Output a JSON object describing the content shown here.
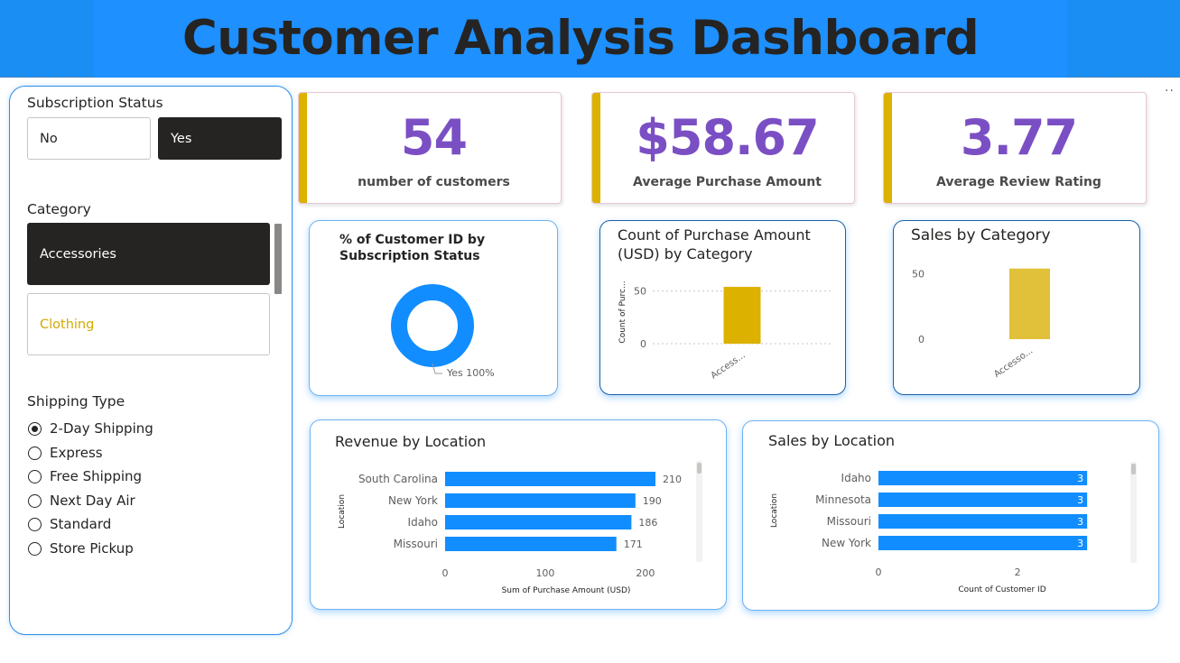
{
  "header": {
    "title": "Customer Analysis Dashboard",
    "more_options": "··"
  },
  "colors": {
    "header_blue": "#1e90ff",
    "kpi_value_purple": "#7b4fc4",
    "kpi_accent_gold": "#dcb100",
    "bar_blue": "#118dff",
    "bar_gold": "#dcb100",
    "selected_tile": "#252423"
  },
  "filters": {
    "subscription": {
      "title": "Subscription Status",
      "options": [
        {
          "label": "No",
          "selected": false
        },
        {
          "label": "Yes",
          "selected": true
        }
      ]
    },
    "category": {
      "title": "Category",
      "options": [
        {
          "label": "Accessories",
          "selected": true
        },
        {
          "label": "Clothing",
          "selected": false
        }
      ]
    },
    "shipping": {
      "title": "Shipping Type",
      "options": [
        {
          "label": "2-Day Shipping",
          "selected": true
        },
        {
          "label": "Express",
          "selected": false
        },
        {
          "label": "Free Shipping",
          "selected": false
        },
        {
          "label": "Next Day Air",
          "selected": false
        },
        {
          "label": "Standard",
          "selected": false
        },
        {
          "label": "Store Pickup",
          "selected": false
        }
      ]
    }
  },
  "kpis": [
    {
      "value": "54",
      "label": "number of customers"
    },
    {
      "value": "$58.67",
      "label": "Average Purchase Amount"
    },
    {
      "value": "3.77",
      "label": "Average Review Rating"
    }
  ],
  "chart_data": [
    {
      "type": "pie",
      "title": "% of Customer ID by Subscription Status",
      "slices": [
        {
          "label": "Yes",
          "value": 100,
          "data_label": "Yes 100%"
        }
      ],
      "donut": true
    },
    {
      "type": "bar",
      "title": "Count of Purchase Amount (USD) by Category",
      "categories": [
        "Access..."
      ],
      "values": [
        54
      ],
      "ylabel": "Count of Purc...",
      "ticks": [
        "0",
        "50"
      ],
      "ylim": [
        0,
        60
      ],
      "color": "#dcb100"
    },
    {
      "type": "bar",
      "title": "Sales by Category",
      "categories": [
        "Accesso..."
      ],
      "values": [
        54
      ],
      "ticks": [
        "0",
        "50"
      ],
      "ylim": [
        0,
        60
      ],
      "color": "#e2c13a"
    },
    {
      "type": "bar",
      "orientation": "horizontal",
      "title": "Revenue by Location",
      "categories": [
        "South Carolina",
        "New York",
        "Idaho",
        "Missouri"
      ],
      "values": [
        210,
        190,
        186,
        171
      ],
      "data_labels": [
        "210",
        "190",
        "186",
        "171"
      ],
      "xlabel": "Sum of Purchase Amount (USD)",
      "ylabel": "Location",
      "ticks": [
        "0",
        "100",
        "200"
      ],
      "xlim": [
        0,
        210
      ]
    },
    {
      "type": "bar",
      "orientation": "horizontal",
      "title": "Sales by Location",
      "categories": [
        "Idaho",
        "Minnesota",
        "Missouri",
        "New York"
      ],
      "values": [
        3,
        3,
        3,
        3
      ],
      "data_labels": [
        "3",
        "3",
        "3",
        "3"
      ],
      "xlabel": "Count of Customer ID",
      "ylabel": "Location",
      "ticks": [
        "0",
        "2"
      ],
      "xlim": [
        0,
        3.4
      ]
    }
  ]
}
